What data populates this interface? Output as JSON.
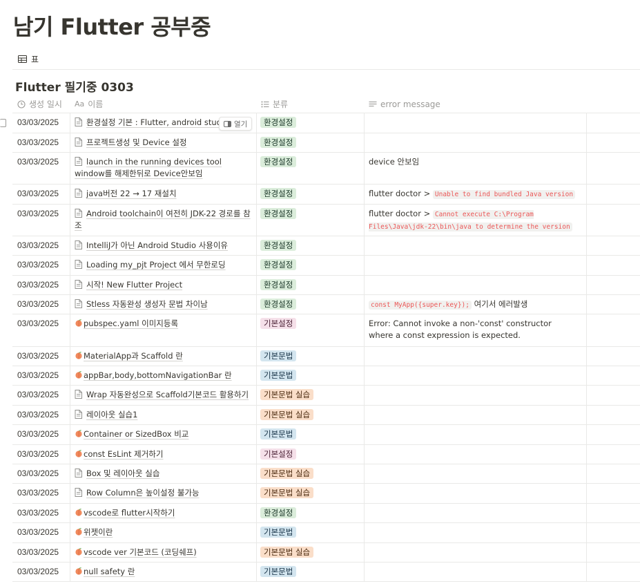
{
  "page": {
    "title": "남기 Flutter 공부중"
  },
  "view_tab": {
    "icon": "table-icon",
    "label": "표"
  },
  "database": {
    "title": "Flutter 필기중 0303",
    "columns": [
      {
        "key": "created",
        "icon": "clock-icon",
        "label": "생성 일시"
      },
      {
        "key": "name",
        "icon": "text-aa-icon",
        "label": "이름"
      },
      {
        "key": "category",
        "icon": "list-icon",
        "label": "분류"
      },
      {
        "key": "error",
        "icon": "text-lines-icon",
        "label": "error message"
      }
    ],
    "open_button_label": "열기",
    "tag_colors": {
      "green": "#dbeddb",
      "pink": "#f5e0e9",
      "blue": "#d3e5ef",
      "orange": "#fadec9"
    },
    "rows": [
      {
        "date": "03/03/2025",
        "name": "환경설정 기본 : Flutter, android studio",
        "icon": "page",
        "tag": "환경설정",
        "tag_color": "green",
        "height": 29,
        "open_button": true,
        "error": []
      },
      {
        "date": "03/03/2025",
        "name": "프로젝트생성 및 Device 설정",
        "icon": "page",
        "tag": "환경설정",
        "tag_color": "green",
        "height": 28,
        "error": []
      },
      {
        "date": "03/03/2025",
        "name": "launch in the running devices tool window를 해제한뒤로 Device안보임",
        "icon": "page",
        "tag": "환경설정",
        "tag_color": "green",
        "height": 46,
        "error": [
          {
            "text": "device 안보임"
          }
        ]
      },
      {
        "date": "03/03/2025",
        "name": "java버전 22 → 17 재설치",
        "icon": "page",
        "tag": "환경설정",
        "tag_color": "green",
        "height": 29,
        "error": [
          {
            "text": "flutter doctor > "
          },
          {
            "code": "Unable to find bundled Java version"
          }
        ]
      },
      {
        "date": "03/03/2025",
        "name": "Android toolchain이 여전히 JDK-22 경로를 참조",
        "icon": "page",
        "tag": "환경설정",
        "tag_color": "green",
        "height": 46,
        "error": [
          {
            "text": "flutter doctor > "
          },
          {
            "code": "Cannot execute C:\\Program Files\\Java\\jdk-22\\bin\\java to determine the version"
          }
        ]
      },
      {
        "date": "03/03/2025",
        "name": "IntelliJ가 아닌 Android Studio 사용이유",
        "icon": "page",
        "tag": "환경설정",
        "tag_color": "green",
        "height": 28,
        "error": []
      },
      {
        "date": "03/03/2025",
        "name": "Loading my_pjt Project 에서 무한로딩",
        "icon": "page",
        "tag": "환경설정",
        "tag_color": "green",
        "height": 29,
        "error": []
      },
      {
        "date": "03/03/2025",
        "name": "시작! New Flutter Project",
        "icon": "page",
        "tag": "환경설정",
        "tag_color": "green",
        "height": 28,
        "error": []
      },
      {
        "date": "03/03/2025",
        "name": "Stless 자동완성 생성자 문법 차이남",
        "icon": "page",
        "tag": "환경설정",
        "tag_color": "green",
        "height": 28,
        "error": [
          {
            "code": "const MyApp({super.key});"
          },
          {
            "text": " 여기서 에러발생"
          }
        ]
      },
      {
        "date": "03/03/2025",
        "name": "pubspec.yaml 이미지등록",
        "icon": "peach",
        "tag": "기본설정",
        "tag_color": "pink",
        "height": 47,
        "error": [
          {
            "text": "Error: Cannot invoke a non-'const' constructor where a const expression is expected."
          }
        ]
      },
      {
        "date": "03/03/2025",
        "name": "MaterialApp과 Scaffold 란",
        "icon": "peach",
        "tag": "기본문법",
        "tag_color": "blue",
        "height": 28,
        "error": []
      },
      {
        "date": "03/03/2025",
        "name": "appBar,body,bottomNavigationBar 란",
        "icon": "peach",
        "tag": "기본문법",
        "tag_color": "blue",
        "height": 28,
        "error": []
      },
      {
        "date": "03/03/2025",
        "name": "Wrap 자동완성으로 Scaffold기본코드 활용하기",
        "icon": "page",
        "tag": "기본문법 실습",
        "tag_color": "orange",
        "height": 29,
        "error": []
      },
      {
        "date": "03/03/2025",
        "name": "레이아웃 실습1",
        "icon": "page",
        "tag": "기본문법 실습",
        "tag_color": "orange",
        "height": 28,
        "error": []
      },
      {
        "date": "03/03/2025",
        "name": "Container or SizedBox 비교",
        "icon": "peach",
        "tag": "기본문법",
        "tag_color": "blue",
        "height": 29,
        "error": []
      },
      {
        "date": "03/03/2025",
        "name": "const EsLint 제거하기",
        "icon": "peach",
        "tag": "기본설정",
        "tag_color": "pink",
        "height": 28,
        "error": []
      },
      {
        "date": "03/03/2025",
        "name": "Box 및 레이아웃 실습",
        "icon": "page",
        "tag": "기본문법 실습",
        "tag_color": "orange",
        "height": 28,
        "error": []
      },
      {
        "date": "03/03/2025",
        "name": "Row Column은 높이설정 불가능",
        "icon": "page",
        "tag": "기본문법 실습",
        "tag_color": "orange",
        "height": 29,
        "error": []
      },
      {
        "date": "03/03/2025",
        "name": "vscode로 flutter시작하기",
        "icon": "peach",
        "tag": "환경설정",
        "tag_color": "green",
        "height": 28,
        "error": []
      },
      {
        "date": "03/03/2025",
        "name": "위젯이란",
        "icon": "peach",
        "tag": "기본문법",
        "tag_color": "blue",
        "height": 29,
        "error": []
      },
      {
        "date": "03/03/2025",
        "name": "vscode ver 기본코드 (코딩쉐프)",
        "icon": "peach",
        "tag": "기본문법 실습",
        "tag_color": "orange",
        "height": 28,
        "error": []
      },
      {
        "date": "03/03/2025",
        "name": "null safety 란",
        "icon": "peach",
        "tag": "기본문법",
        "tag_color": "blue",
        "height": 28,
        "error": []
      }
    ]
  }
}
